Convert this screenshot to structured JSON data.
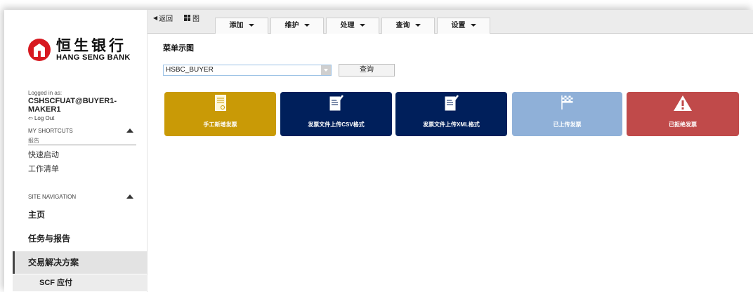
{
  "brand": {
    "name_cn": "恒生银行",
    "name_en": "HANG SENG BANK"
  },
  "user": {
    "logged_in_label": "Logged in as:",
    "username": "CSHSCFUAT@BUYER1-MAKER1",
    "logout": "Log Out",
    "logout_icon": "⇦"
  },
  "shortcuts": {
    "title": "MY SHORTCUTS",
    "items": [
      "报告",
      "快速启动",
      "工作清单"
    ]
  },
  "site_nav": {
    "title": "SITE NAVIGATION",
    "items": [
      "主页",
      "任务与报告",
      "交易解决方案"
    ],
    "sub_item": "SCF 应付"
  },
  "topbar": {
    "back": "返回",
    "diagram": "图",
    "tabs": [
      "添加",
      "维护",
      "处理",
      "查询",
      "设置"
    ]
  },
  "main": {
    "title": "菜单示图",
    "select_value": "HSBC_BUYER",
    "query_button": "查询"
  },
  "tiles": [
    {
      "label": "手工新增发票",
      "icon": "document-icon",
      "color": "#c99a06"
    },
    {
      "label": "发票文件上传CSV格式",
      "icon": "document-check-icon",
      "color": "#001f5b"
    },
    {
      "label": "发票文件上传XML格式",
      "icon": "document-check-icon",
      "color": "#001f5b"
    },
    {
      "label": "已上传发票",
      "icon": "flag-icon",
      "color": "#8fb0d8"
    },
    {
      "label": "已拒绝发票",
      "icon": "warning-icon",
      "color": "#c04a4a"
    }
  ]
}
